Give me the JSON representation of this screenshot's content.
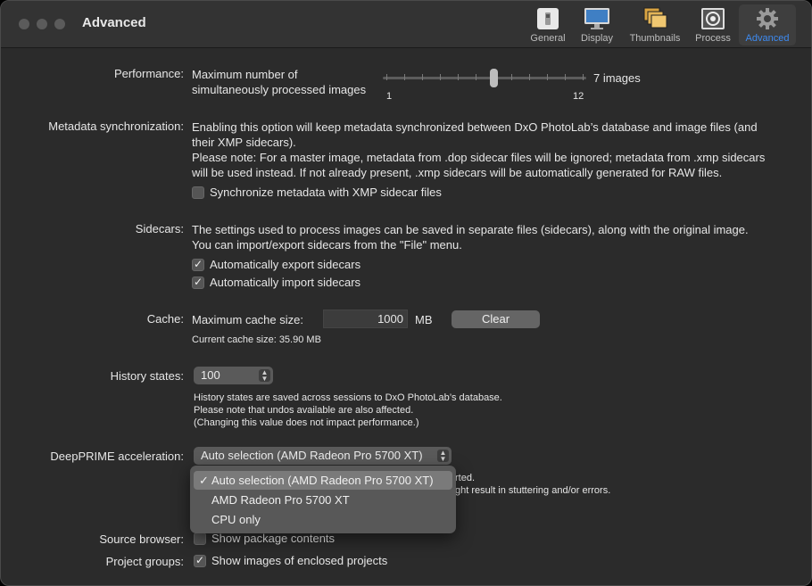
{
  "window": {
    "title": "Advanced"
  },
  "toolbar": {
    "items": [
      {
        "label": "General",
        "icon": "general-icon"
      },
      {
        "label": "Display",
        "icon": "display-icon"
      },
      {
        "label": "Thumbnails",
        "icon": "thumbnails-icon"
      },
      {
        "label": "Process",
        "icon": "process-icon"
      },
      {
        "label": "Advanced",
        "icon": "gear-icon",
        "active": true
      }
    ],
    "accent": "#3d8bf2"
  },
  "performance": {
    "label": "Performance:",
    "description_line1": "Maximum number of",
    "description_line2": "simultaneously processed images",
    "slider_min": "1",
    "slider_max": "12",
    "slider_value": 7,
    "value_text": "7 images"
  },
  "metadata": {
    "label": "Metadata synchronization:",
    "line1": "Enabling this option will keep metadata synchronized between DxO PhotoLab’s database and image files (and",
    "line2": "their XMP sidecars).",
    "line3": "Please note: For a master image, metadata from .dop sidecar files will be ignored; metadata from .xmp sidecars",
    "line4": "will be used instead. If not already present, .xmp sidecars will be automatically generated for RAW files.",
    "checkbox_label": "Synchronize metadata with XMP sidecar files",
    "checked": false
  },
  "sidecars": {
    "label": "Sidecars:",
    "line1": "The settings used to process images can be saved in separate files (sidecars), along with the original image.",
    "line2": "You can import/export sidecars from the \"File\" menu.",
    "export_label": "Automatically export sidecars",
    "export_checked": true,
    "import_label": "Automatically import sidecars",
    "import_checked": true
  },
  "cache": {
    "label": "Cache:",
    "max_label": "Maximum cache size:",
    "value": "1000",
    "unit": "MB",
    "clear_label": "Clear",
    "current": "Current cache size: 35.90 MB"
  },
  "history": {
    "label": "History states:",
    "value": "100",
    "note1": "History states are saved across sessions to DxO PhotoLab’s database.",
    "note2": "Please note that undos available are also affected.",
    "note3": "(Changing this value does not impact performance.)"
  },
  "deepprime": {
    "label": "DeepPRIME acceleration:",
    "selected": "Auto selection (AMD Radeon Pro 5700 XT)",
    "note1_partial": "rted.",
    "note2_partial": "ght result in stuttering and/or errors.",
    "options": [
      {
        "label": "Auto selection (AMD Radeon Pro 5700 XT)",
        "selected": true
      },
      {
        "label": "AMD Radeon Pro 5700 XT",
        "selected": false
      },
      {
        "label": "CPU only",
        "selected": false
      }
    ]
  },
  "source_browser": {
    "label": "Source browser:",
    "checkbox_label": "Show package contents",
    "checked": false
  },
  "project_groups": {
    "label": "Project groups:",
    "checkbox_label": "Show images of enclosed projects",
    "checked": true
  }
}
